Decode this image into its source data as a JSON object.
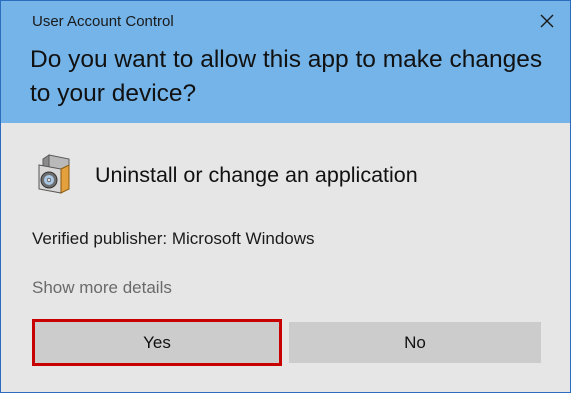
{
  "window": {
    "title": "User Account Control"
  },
  "prompt": {
    "question": "Do you want to allow this app to make changes to your device?"
  },
  "app": {
    "name": "Uninstall or change an application",
    "icon": "programs-cd-box-icon"
  },
  "publisher": {
    "text": "Verified publisher: Microsoft Windows"
  },
  "details": {
    "link_label": "Show more details"
  },
  "buttons": {
    "yes_label": "Yes",
    "no_label": "No"
  },
  "colors": {
    "header_bg": "#74b4e8",
    "body_bg": "#e6e6e6",
    "focus_border": "#c80000",
    "button_bg": "#cccccc"
  }
}
